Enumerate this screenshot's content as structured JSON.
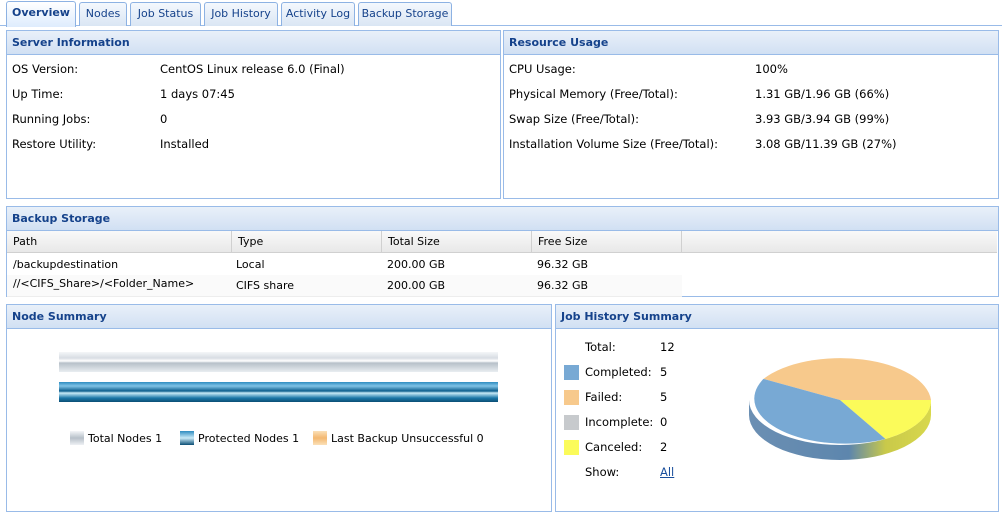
{
  "tabs": [
    "Overview",
    "Nodes",
    "Job Status",
    "Job History",
    "Activity Log",
    "Backup Storage"
  ],
  "server_info": {
    "title": "Server Information",
    "rows": [
      {
        "label": "OS Version:",
        "value": "CentOS Linux release 6.0 (Final)"
      },
      {
        "label": "Up Time:",
        "value": "1 days 07:45"
      },
      {
        "label": "Running Jobs:",
        "value": "0"
      },
      {
        "label": "Restore Utility:",
        "value": "Installed"
      }
    ]
  },
  "resource_usage": {
    "title": "Resource Usage",
    "rows": [
      {
        "label": "CPU Usage:",
        "value": "100%"
      },
      {
        "label": "Physical Memory (Free/Total):",
        "value": "1.31 GB/1.96 GB (66%)"
      },
      {
        "label": "Swap Size (Free/Total):",
        "value": "3.93 GB/3.94 GB (99%)"
      },
      {
        "label": "Installation Volume Size (Free/Total):",
        "value": "3.08 GB/11.39 GB (27%)"
      }
    ]
  },
  "backup_storage": {
    "title": "Backup Storage",
    "columns": [
      "Path",
      "Type",
      "Total Size",
      "Free Size"
    ],
    "rows": [
      [
        "/backupdestination",
        "Local",
        "200.00 GB",
        "96.32 GB"
      ],
      [
        "//<CIFS_Share>/<Folder_Name>",
        "CIFS share",
        "200.00 GB",
        "96.32 GB"
      ]
    ]
  },
  "node_summary": {
    "title": "Node Summary",
    "legend": [
      {
        "label": "Total Nodes 1",
        "color": "#d8dee5"
      },
      {
        "label": "Protected Nodes 1",
        "color": "#1c77a8"
      },
      {
        "label": "Last Backup Unsuccessful 0",
        "color": "#f7c98c"
      }
    ]
  },
  "job_history": {
    "title": "Job History Summary",
    "total_label": "Total:",
    "total_value": "12",
    "items": [
      {
        "label": "Completed:",
        "value": "5",
        "color": "#78a9d4"
      },
      {
        "label": "Failed:",
        "value": "5",
        "color": "#f7c98c"
      },
      {
        "label": "Incomplete:",
        "value": "0",
        "color": "#c7cacd"
      },
      {
        "label": "Canceled:",
        "value": "2",
        "color": "#fbfb5a"
      }
    ],
    "show_label": "Show:",
    "show_link": "All"
  }
}
